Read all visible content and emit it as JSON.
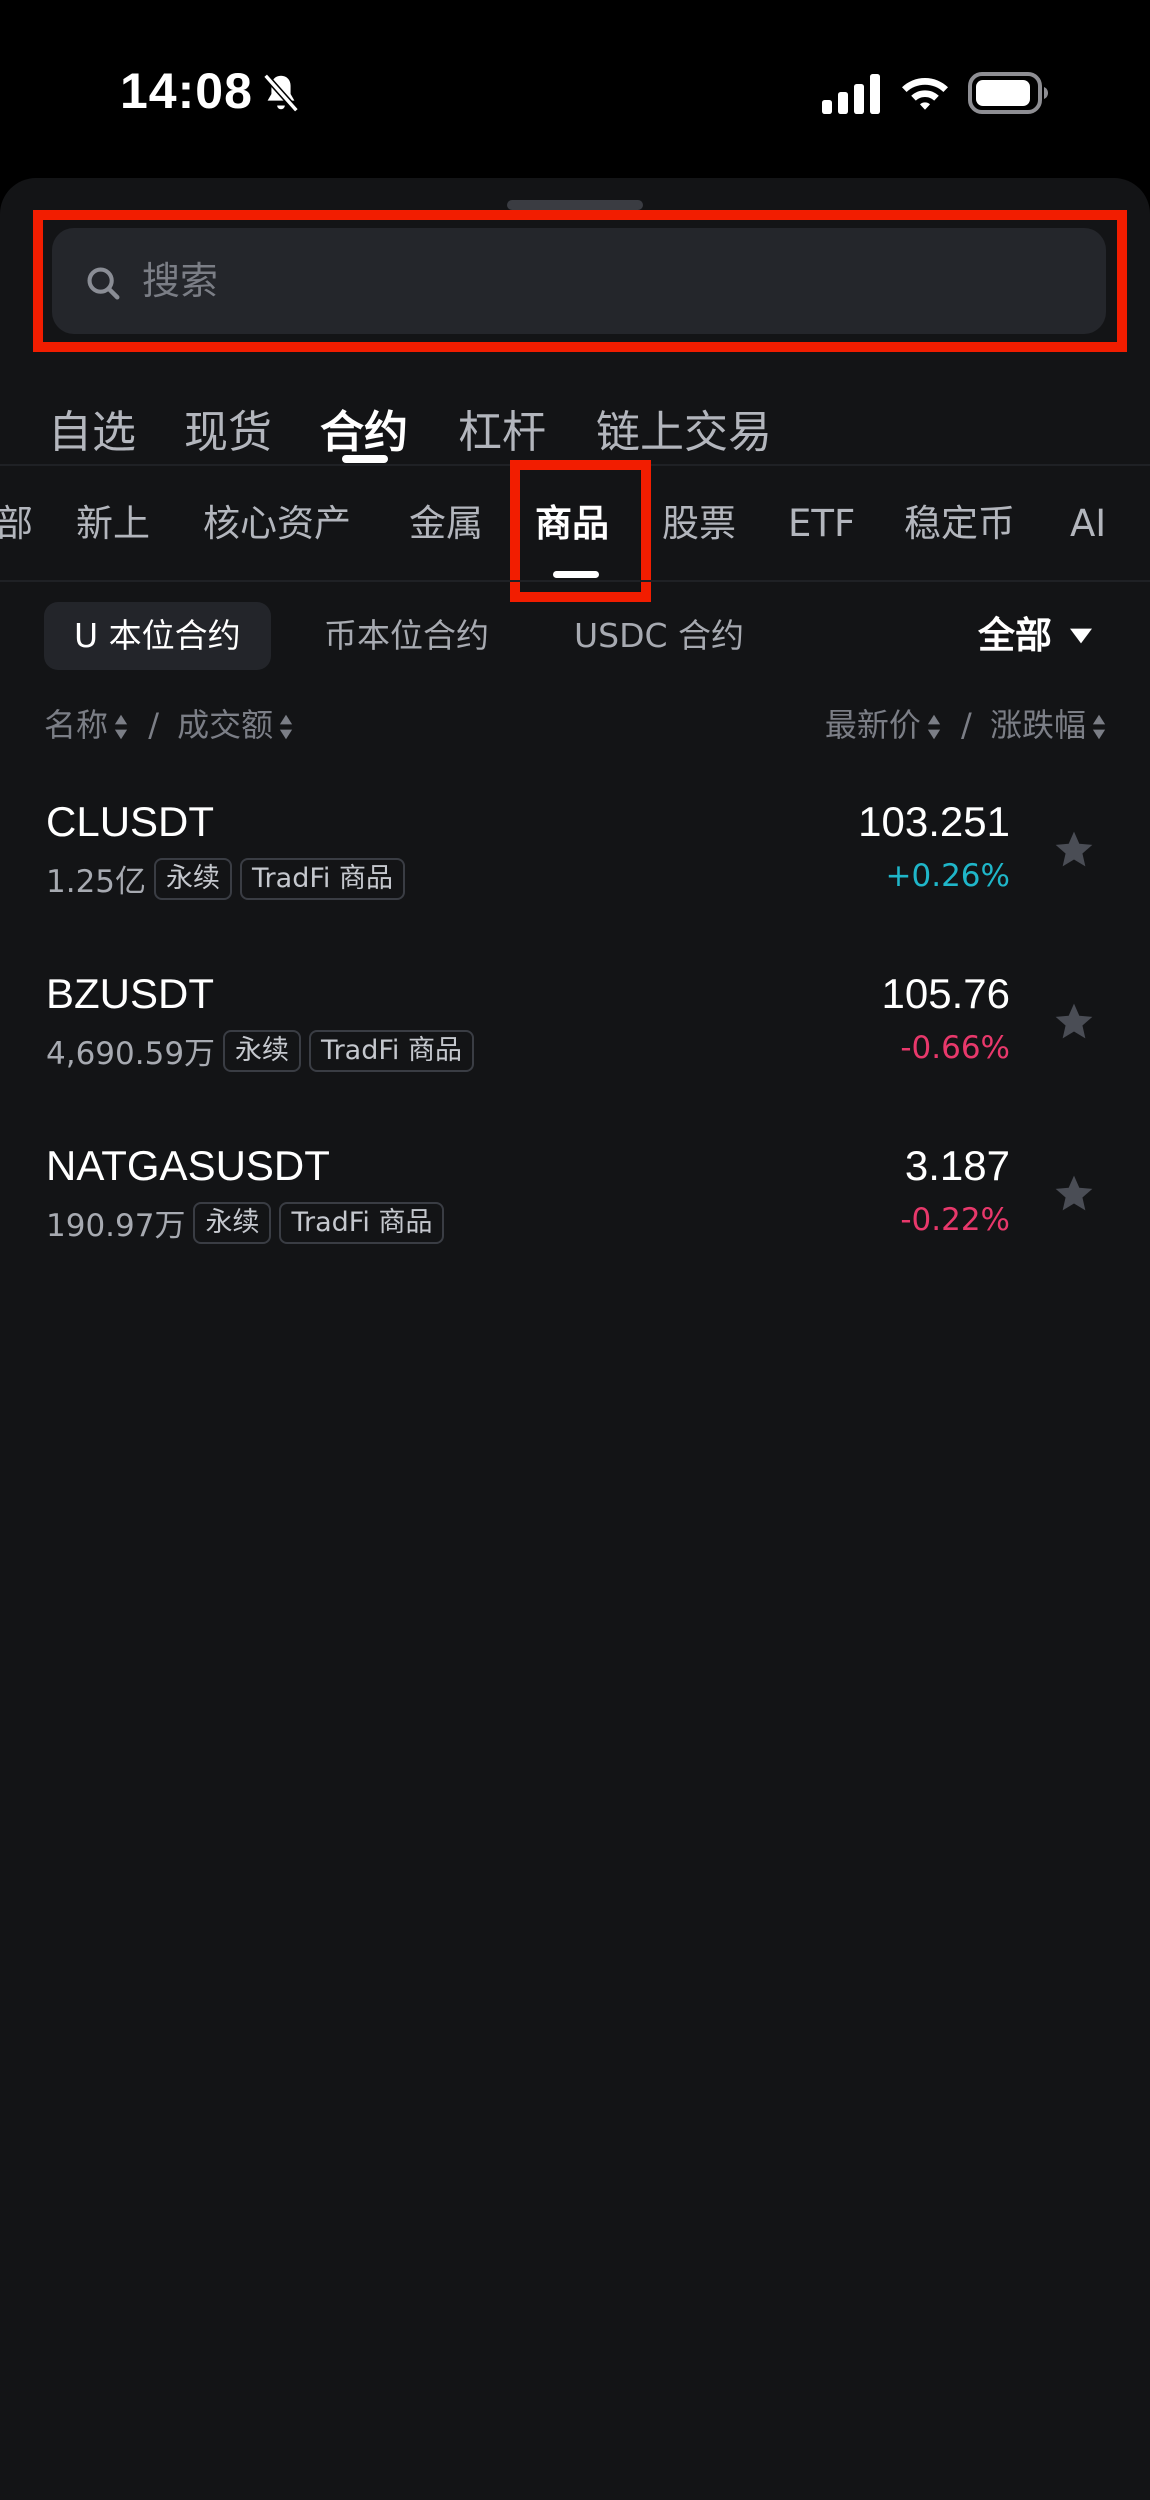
{
  "status_bar": {
    "time": "14:08",
    "icons": [
      "bell-slash-icon",
      "cellular-signal-icon",
      "wifi-icon",
      "battery-icon"
    ]
  },
  "search": {
    "placeholder": "搜索",
    "value": ""
  },
  "primary_tabs": [
    {
      "label": "自选",
      "active": false
    },
    {
      "label": "现货",
      "active": false
    },
    {
      "label": "合约",
      "active": true
    },
    {
      "label": "杠杆",
      "active": false
    },
    {
      "label": "链上交易",
      "active": false
    }
  ],
  "secondary_tabs": [
    {
      "label": "部",
      "active": false
    },
    {
      "label": "新上",
      "active": false
    },
    {
      "label": "核心资产",
      "active": false
    },
    {
      "label": "金属",
      "active": false
    },
    {
      "label": "商品",
      "active": true
    },
    {
      "label": "股票",
      "active": false
    },
    {
      "label": "ETF",
      "active": false
    },
    {
      "label": "稳定币",
      "active": false
    },
    {
      "label": "AI",
      "active": false
    }
  ],
  "filters": {
    "chips": [
      {
        "label": "U 本位合约",
        "active": true
      },
      {
        "label": "币本位合约",
        "active": false
      },
      {
        "label": "USDC 合约",
        "active": false
      }
    ],
    "scope": "全部"
  },
  "columns": {
    "name": "名称",
    "separator_left": "/",
    "volume": "成交额",
    "price": "最新价",
    "separator_right": "/",
    "change": "涨跌幅"
  },
  "rows": [
    {
      "symbol": "CLUSDT",
      "volume": "1.25亿",
      "tags": [
        "永续",
        "TradFi 商品"
      ],
      "price": "103.251",
      "change": "+0.26%",
      "direction": "up"
    },
    {
      "symbol": "BZUSDT",
      "volume": "4,690.59万",
      "tags": [
        "永续",
        "TradFi 商品"
      ],
      "price": "105.76",
      "change": "-0.66%",
      "direction": "down"
    },
    {
      "symbol": "NATGASUSDT",
      "volume": "190.97万",
      "tags": [
        "永续",
        "TradFi 商品"
      ],
      "price": "3.187",
      "change": "-0.22%",
      "direction": "down"
    }
  ],
  "colors": {
    "background": "#131416",
    "highlight": "#f21d00",
    "up": "#1fb6c9",
    "down": "#e8386b",
    "star": "#4a4d55"
  }
}
